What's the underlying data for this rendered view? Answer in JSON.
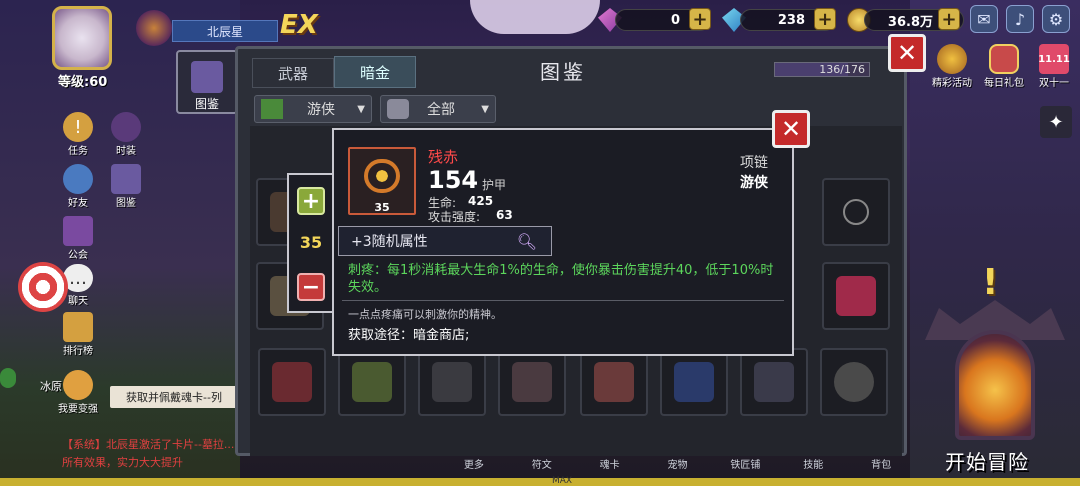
{
  "resources": {
    "gem_value": "0",
    "diamond_value": "238",
    "coin_value": "36.8万"
  },
  "player": {
    "name": "北辰星",
    "level_label": "等级:60",
    "rank_badge": "EX"
  },
  "left_menu": {
    "codex_label": "图鉴",
    "items": [
      "任务",
      "时装",
      "好友",
      "图鉴",
      "公会",
      "聊天",
      "排行榜",
      "我要变强"
    ],
    "side_text": "冰原"
  },
  "right_menu": {
    "items": [
      "精彩活动",
      "每日礼包",
      "双十一"
    ]
  },
  "panel": {
    "title": "图鉴",
    "tabs": [
      "武器",
      "暗金"
    ],
    "active_tab": "暗金",
    "progress_text": "136/176",
    "progress_fraction": 0.773,
    "filter_class": "游侠",
    "filter_scope": "全部"
  },
  "item": {
    "name": "残赤",
    "level": "35",
    "armor_value": "154",
    "armor_label": "护甲",
    "stats": [
      {
        "label": "生命:",
        "value": "425"
      },
      {
        "label": "攻击强度:",
        "value": "63"
      }
    ],
    "slot_type": "项链",
    "class_type": "游侠",
    "random_attr": "+3随机属性",
    "effect": "刺疼：每1秒消耗最大生命1%的生命，使你暴击伤害提升40，低于10%时失效。",
    "flavor": "一点点疼痛可以刺激你的精神。",
    "source": "获取途径：暗金商店;"
  },
  "quantity": {
    "value": "35"
  },
  "tooltip": {
    "text": "获取并佩戴魂卡--列",
    "system_msg": "【系统】北辰星激活了卡片--墓拉...所有效果，实力大大提升"
  },
  "bottom_nav": [
    "更多",
    "符文",
    "魂卡",
    "宠物",
    "铁匠铺",
    "技能",
    "背包"
  ],
  "bottom_max": "MAX",
  "start_button": "开始冒险",
  "colors": {
    "item_name": "#ff4a4a",
    "effect_text": "#5cd65c",
    "close_red": "#c42a2a",
    "plus_green": "#8aa83a",
    "minus_red": "#c43a3a",
    "qty_yellow": "#f3d65a"
  }
}
